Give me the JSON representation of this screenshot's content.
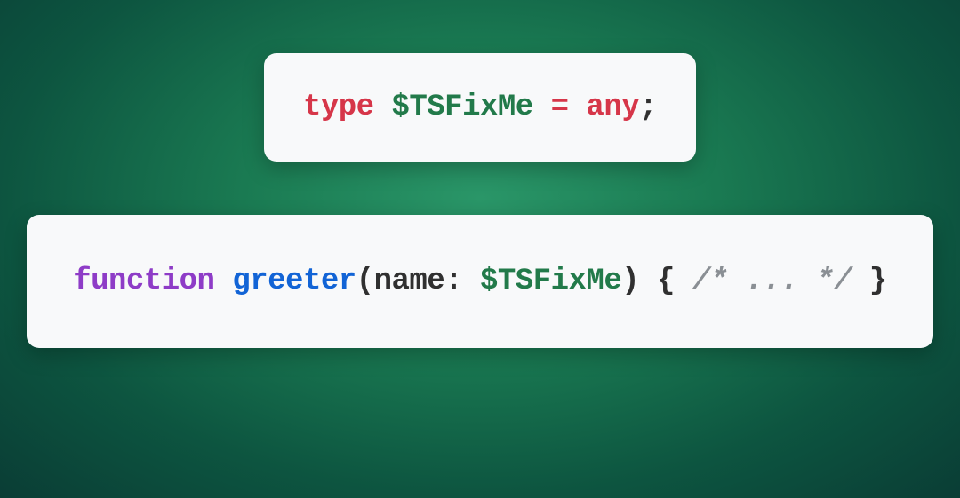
{
  "snippet1": {
    "keyword_type": "type",
    "type_identifier": "$TSFixMe",
    "equals": "=",
    "keyword_any": "any",
    "semicolon": ";"
  },
  "snippet2": {
    "keyword_function": "function",
    "function_name": "greeter",
    "open_paren": "(",
    "param_name": "name",
    "colon": ":",
    "param_type": "$TSFixMe",
    "close_paren": ")",
    "open_brace": "{",
    "comment": "/* ... */",
    "close_brace": "}"
  }
}
